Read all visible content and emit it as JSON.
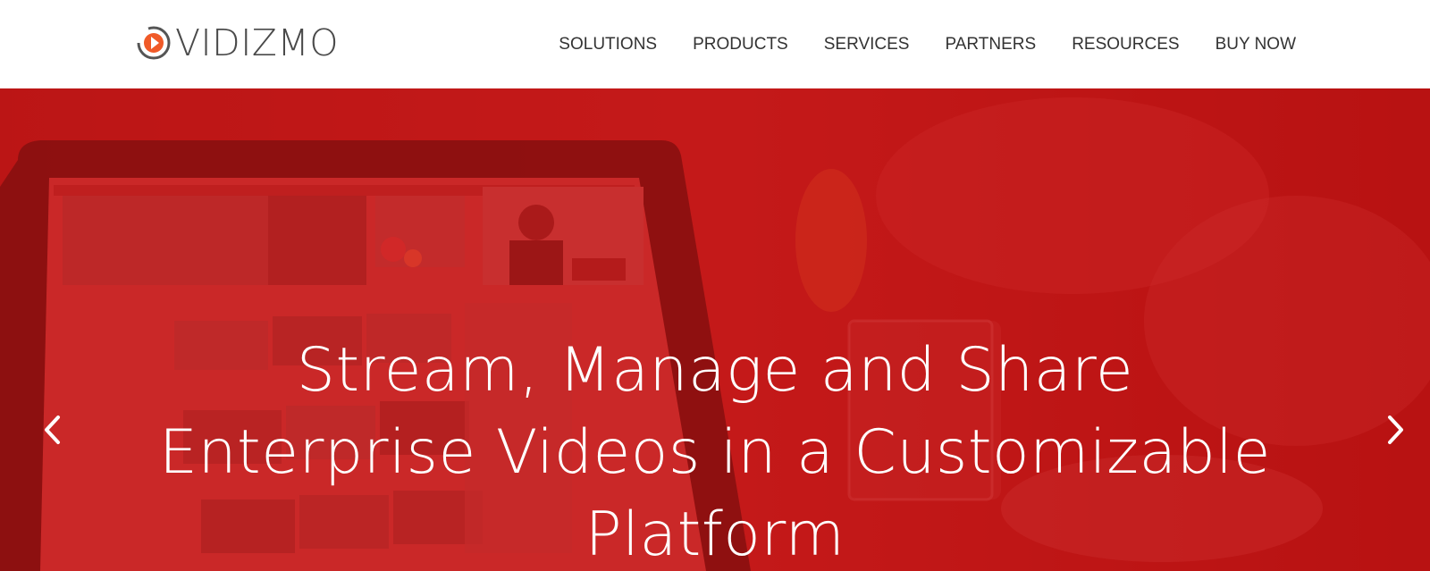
{
  "header": {
    "logo_text": "VIDIZMO",
    "nav": [
      {
        "label": "SOLUTIONS"
      },
      {
        "label": "PRODUCTS"
      },
      {
        "label": "SERVICES"
      },
      {
        "label": "PARTNERS"
      },
      {
        "label": "RESOURCES"
      },
      {
        "label": "BUY NOW"
      }
    ]
  },
  "hero": {
    "title_lines": [
      "Stream, Manage and Share",
      "Enterprise Videos in a Customizable",
      "Platform"
    ],
    "prev_icon": "chevron-left-icon",
    "next_icon": "chevron-right-icon"
  },
  "colors": {
    "brand_red": "#c41414",
    "logo_orange": "#f05a28",
    "text_dark": "#333333"
  }
}
